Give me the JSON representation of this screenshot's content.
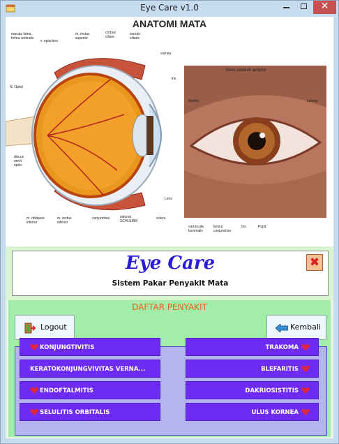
{
  "window": {
    "title": "Eye Care v1.0",
    "controls": {
      "minimize": "–",
      "maximize": "□",
      "close": "✕"
    }
  },
  "anatomy": {
    "title": "ANATOMI MATA",
    "side_labels": [
      "macula lutea, fovea centralis",
      "v. episclera",
      "m. rectus superior",
      "corpus ciliare",
      "zonula ciliaris",
      "cornea",
      "iris",
      "N. Optici",
      "discus nervi optici",
      "m. obliquus inferior",
      "m. rectus inferior",
      "conjunctiva",
      "saluran SCHLEMM",
      "sclera",
      "Lens"
    ],
    "anterior_title": "Mata sebelah anterior",
    "anterior_labels": [
      "Medial",
      "Lateral",
      "caruncula lacrimalis",
      "tunica conjunctiva",
      "Iris",
      "Pupil"
    ]
  },
  "header": {
    "title": "Eye Care",
    "subtitle": "Sistem Pakar Penyakit Mata"
  },
  "panel": {
    "heading": "DAFTAR PENYAKIT",
    "logout_label": "Logout",
    "back_label": "Kembali"
  },
  "diseases": {
    "left": [
      "KONJUNGTIVITIS",
      "KERATOKONJUNGVIVITAS VERNA...",
      "ENDOFTALMITIS",
      "SELULITIS ORBITALIS"
    ],
    "right": [
      "TRAKOMA",
      "BLEFARITIS",
      "DAKRIOSISTITIS",
      "ULUS KORNEA"
    ]
  },
  "colors": {
    "accent": "#2a1cd6",
    "button_purple": "#6e2bf3",
    "panel_green": "#a2eda9",
    "heading_orange": "#e8621a",
    "heart_red": "#e0263a"
  }
}
